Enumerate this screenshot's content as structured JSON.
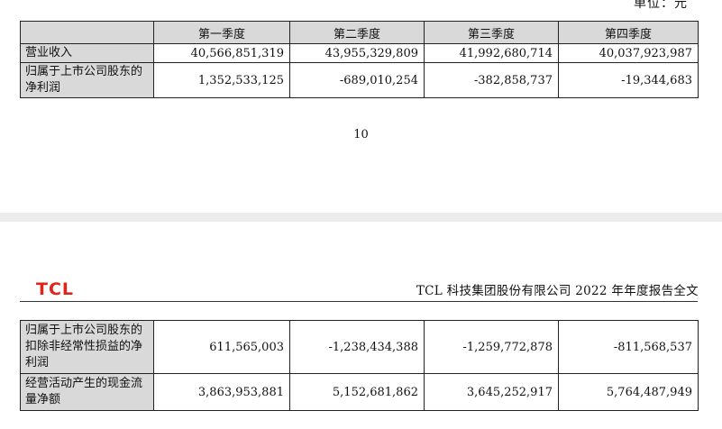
{
  "unit_label": "单位：元",
  "columns": [
    "第一季度",
    "第二季度",
    "第三季度",
    "第四季度"
  ],
  "table_top": [
    {
      "label": "营业收入",
      "values": [
        "40,566,851,319",
        "43,955,329,809",
        "41,992,680,714",
        "40,037,923,987"
      ]
    },
    {
      "label": "归属于上市公司股东的净利润",
      "values": [
        "1,352,533,125",
        "-689,010,254",
        "-382,858,737",
        "-19,344,683"
      ]
    }
  ],
  "page_number": "10",
  "header": {
    "logo": "TCL",
    "title": "TCL 科技集团股份有限公司 2022 年年度报告全文"
  },
  "table_bottom": [
    {
      "label": "归属于上市公司股东的扣除非经常性损益的净利润",
      "values": [
        "611,565,003",
        "-1,238,434,388",
        "-1,259,772,878",
        "-811,568,537"
      ]
    },
    {
      "label": "经营活动产生的现金流量净额",
      "values": [
        "3,863,953,881",
        "5,152,681,862",
        "3,645,252,917",
        "5,764,487,949"
      ]
    }
  ]
}
